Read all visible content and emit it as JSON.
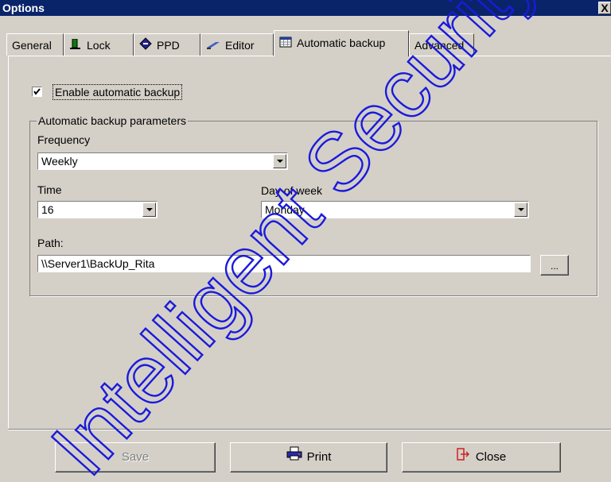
{
  "window": {
    "title": "Options",
    "close_glyph": "X"
  },
  "tabs": [
    {
      "label": "General",
      "icon": null
    },
    {
      "label": "Lock",
      "icon": "lock-icon"
    },
    {
      "label": "PPD",
      "icon": "ppd-icon"
    },
    {
      "label": "Editor",
      "icon": "editor-icon"
    },
    {
      "label": "Automatic backup",
      "icon": "calendar-icon",
      "active": true
    },
    {
      "label": "Advanced",
      "icon": null
    }
  ],
  "backup": {
    "enable_label": "Enable automatic backup",
    "enabled": true,
    "group_title": "Automatic backup parameters",
    "frequency_label": "Frequency",
    "frequency_value": "Weekly",
    "time_label": "Time",
    "time_value": "16",
    "day_label": "Day of week",
    "day_value": "Monday",
    "path_label": "Path:",
    "path_value": "\\\\Server1\\BackUp_Rita",
    "browse_label": "..."
  },
  "footer": {
    "save_label": "Save",
    "save_enabled": false,
    "print_label": "Print",
    "close_label": "Close"
  },
  "watermark": {
    "text": "Intelligent Security &",
    "color": "#1a1adc"
  }
}
